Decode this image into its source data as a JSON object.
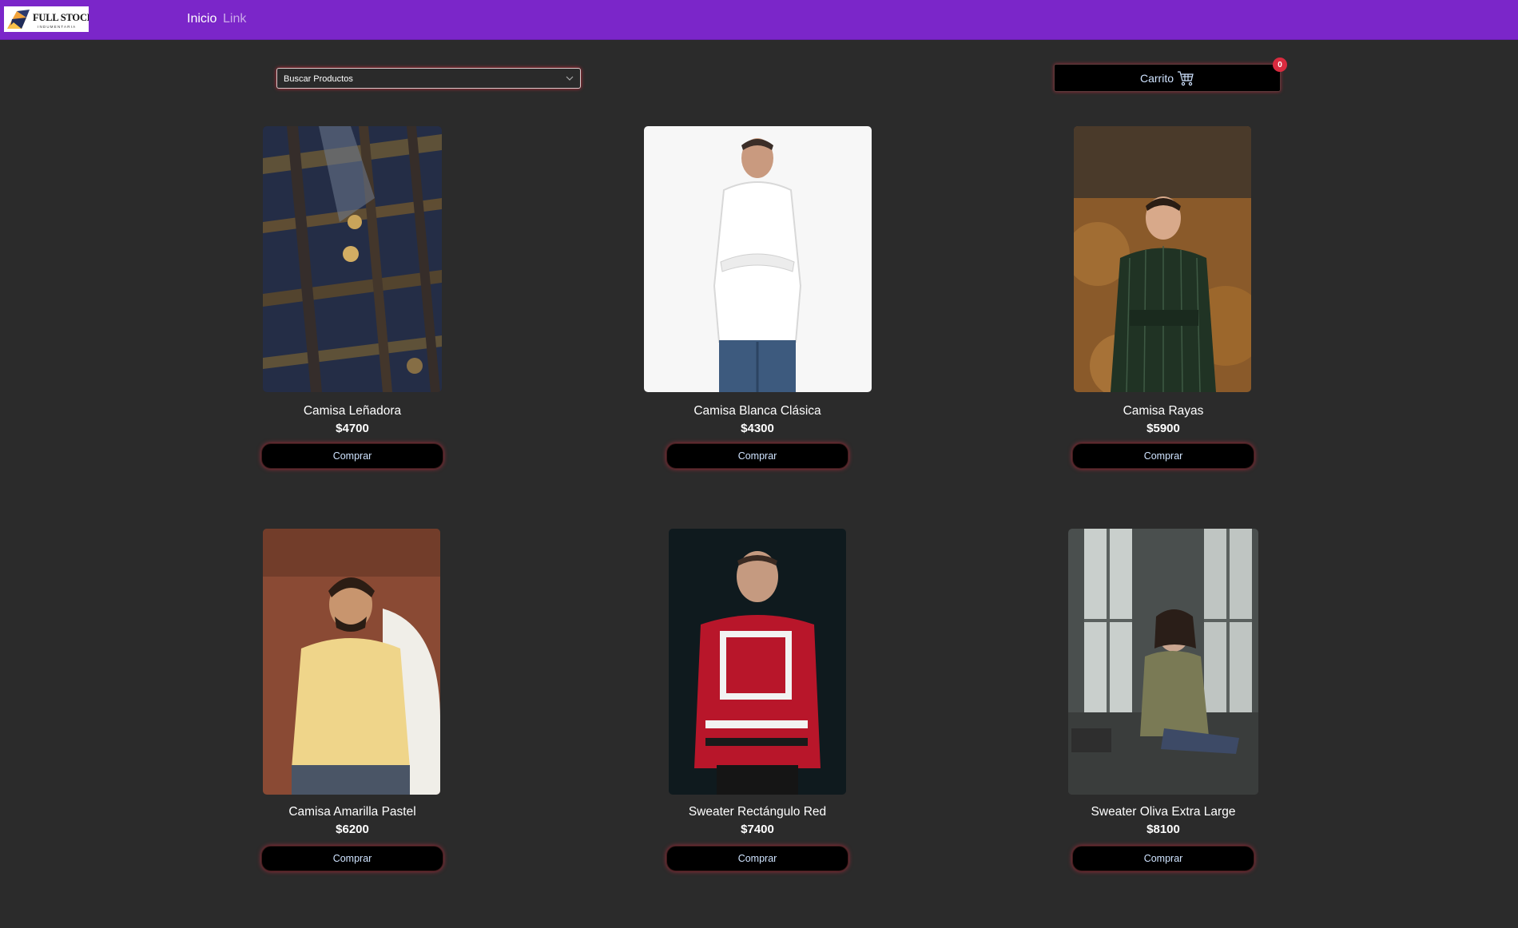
{
  "navbar": {
    "logo_text": "FULL STOCK",
    "logo_sub": "INDUMENTARIA",
    "links": [
      "Inicio",
      "Link"
    ],
    "color": "#7b26c9"
  },
  "search": {
    "selected": "Buscar Productos"
  },
  "cart": {
    "label": "Carrito",
    "count": "0",
    "icon": "cart-icon"
  },
  "products": [
    {
      "name": "Camisa Leñadora",
      "price": "$4700",
      "button": "Comprar"
    },
    {
      "name": "Camisa Blanca Clásica",
      "price": "$4300",
      "button": "Comprar"
    },
    {
      "name": "Camisa Rayas",
      "price": "$5900",
      "button": "Comprar"
    },
    {
      "name": "Camisa Amarilla Pastel",
      "price": "$6200",
      "button": "Comprar"
    },
    {
      "name": "Sweater Rectángulo Red",
      "price": "$7400",
      "button": "Comprar"
    },
    {
      "name": "Sweater Oliva Extra Large",
      "price": "$8100",
      "button": "Comprar"
    }
  ],
  "colors": {
    "background": "#2b2b2b",
    "accent_glow": "#d92b3f",
    "badge": "#d92b3f"
  }
}
